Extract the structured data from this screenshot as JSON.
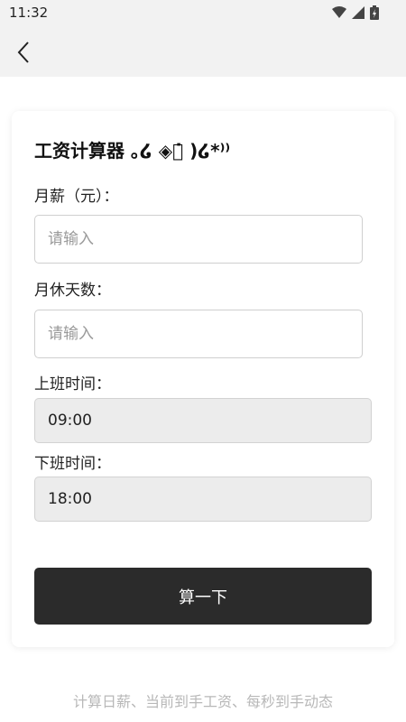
{
  "status_bar": {
    "time": "11:32"
  },
  "card": {
    "title": "工资计算器 ｡໒ ◈⃘̇ )໒*⁾⁾",
    "salary": {
      "label": "月薪（元）：",
      "placeholder": "请输入"
    },
    "rest_days": {
      "label": "月休天数：",
      "placeholder": "请输入"
    },
    "start_time": {
      "label": "上班时间：",
      "value": "09:00"
    },
    "end_time": {
      "label": "下班时间：",
      "value": "18:00"
    },
    "calc_button_label": "算一下"
  },
  "footer": {
    "note": "计算日薪、当前到手工资、每秒到手动态"
  }
}
